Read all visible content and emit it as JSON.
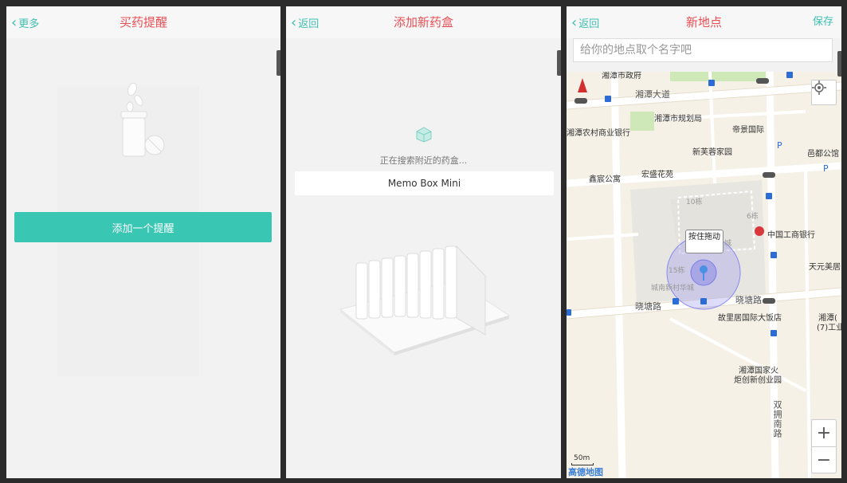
{
  "screen1": {
    "back_label": "更多",
    "title": "买药提醒",
    "add_button": "添加一个提醒"
  },
  "screen2": {
    "back_label": "返回",
    "title": "添加新药盒",
    "searching_text": "正在搜索附近的药盒...",
    "device_name": "Memo Box Mini"
  },
  "screen3": {
    "back_label": "返回",
    "title": "新地点",
    "save_label": "保存",
    "name_placeholder": "给你的地点取个名字吧",
    "tooltip": "按住拖动",
    "zoom_in": "+",
    "zoom_out": "−",
    "scale": "50m",
    "brand": "高德地图",
    "map_labels": {
      "city_gov": "湘潭市政府",
      "xiangtan_ave": "湘潭大道",
      "planning_bureau": "湘潭市规划局",
      "rural_bank": "湘潭农村商业银行",
      "diji": "帝景国际",
      "furong": "新芙蓉家园",
      "xinchen": "鑫宸公寓",
      "hongsheng": "宏盛花苑",
      "b10": "10栋",
      "b6": "6栋",
      "b15": "15栋",
      "icbc": "中国工商银行",
      "tianyuan": "天元美居",
      "xiaotang_w": "晓塘路",
      "xiaotang_e": "晓塘路",
      "gulixiang": "故里居国际大饭店",
      "chengnan": "城南新村华城",
      "national_base_1": "湘潭国家火",
      "national_base_2": "炬创新创业园",
      "right_bank_1": "湘潭(",
      "right_bank_2": "(7)工业",
      "yunjia": "邑都公馆",
      "shuangyong": "双拥南路",
      "cheng": "城"
    }
  },
  "colors": {
    "accent": "#3ebfb1",
    "title_red": "#e84f55",
    "button_teal": "#39c6b3"
  }
}
